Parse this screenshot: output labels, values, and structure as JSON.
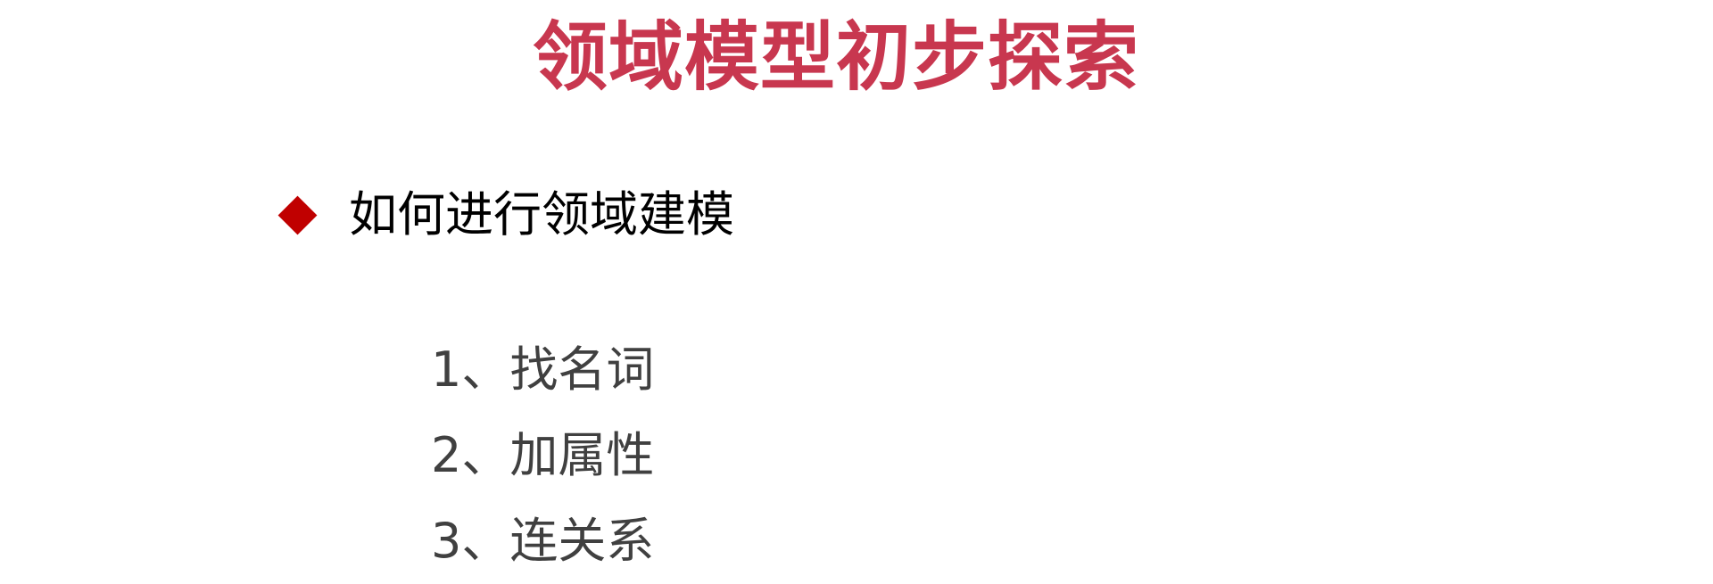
{
  "slide": {
    "title": "领域模型初步探索",
    "title_color": "#C8374F",
    "bullet": {
      "marker_icon": "diamond-bullet-icon",
      "marker_color": "#C00000",
      "text": "如何进行领域建模"
    },
    "steps": [
      "1、找名词",
      "2、加属性",
      "3、连关系"
    ],
    "step_color": "#404040"
  }
}
